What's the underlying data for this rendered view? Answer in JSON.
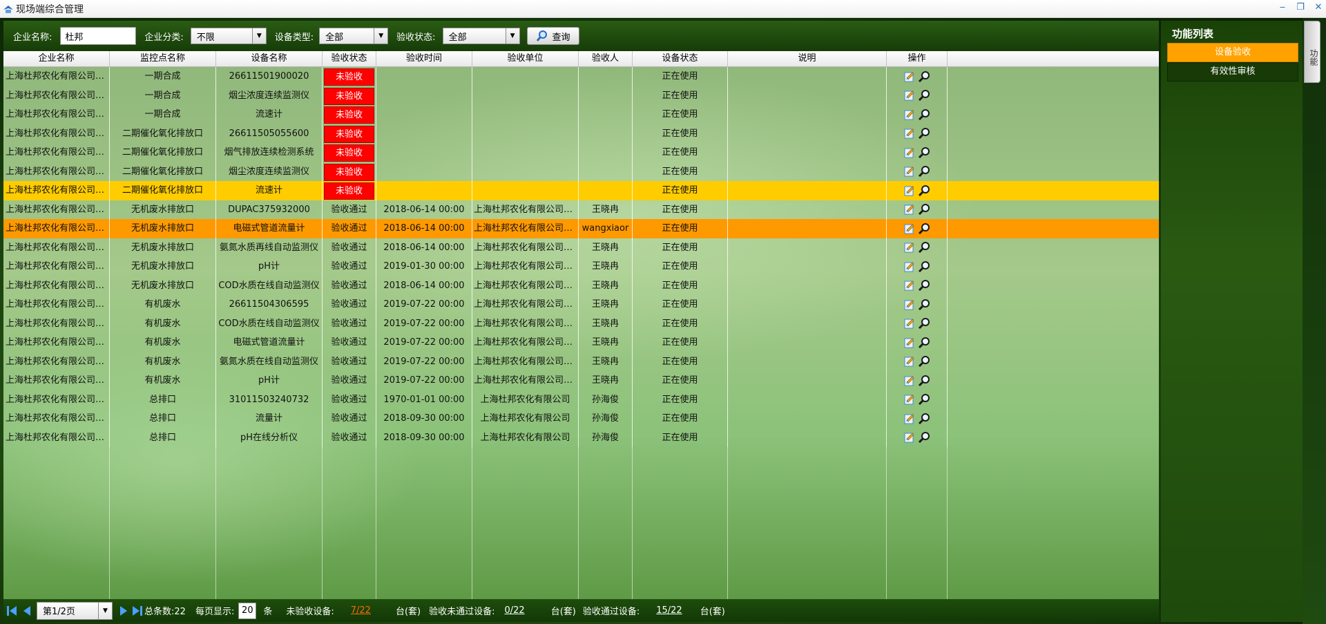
{
  "window": {
    "title": "现场端综合管理",
    "controls": [
      "minimize",
      "restore",
      "close"
    ]
  },
  "toolbar": {
    "company_name_label": "企业名称:",
    "company_name_value": "杜邦",
    "company_category_label": "企业分类:",
    "company_category_value": "不限",
    "device_type_label": "设备类型:",
    "device_type_value": "全部",
    "accept_status_label": "验收状态:",
    "accept_status_value": "全部",
    "query_label": "查询"
  },
  "grid": {
    "columns": [
      "企业名称",
      "监控点名称",
      "设备名称",
      "验收状态",
      "验收时间",
      "验收单位",
      "验收人",
      "设备状态",
      "说明",
      "操作"
    ],
    "rows": [
      {
        "company": "上海杜邦农化有限公司化工区厂",
        "point": "一期合成",
        "device": "26611501900020",
        "status": "未验收",
        "time": "",
        "unit": "",
        "person": "",
        "dstatus": "正在使用",
        "note": "",
        "highlight": ""
      },
      {
        "company": "上海杜邦农化有限公司化工区厂",
        "point": "一期合成",
        "device": "烟尘浓度连续监测仪",
        "status": "未验收",
        "time": "",
        "unit": "",
        "person": "",
        "dstatus": "正在使用",
        "note": "",
        "highlight": ""
      },
      {
        "company": "上海杜邦农化有限公司化工区厂",
        "point": "一期合成",
        "device": "流速计",
        "status": "未验收",
        "time": "",
        "unit": "",
        "person": "",
        "dstatus": "正在使用",
        "note": "",
        "highlight": ""
      },
      {
        "company": "上海杜邦农化有限公司化工区厂",
        "point": "二期催化氧化排放口",
        "device": "26611505055600",
        "status": "未验收",
        "time": "",
        "unit": "",
        "person": "",
        "dstatus": "正在使用",
        "note": "",
        "highlight": ""
      },
      {
        "company": "上海杜邦农化有限公司化工区厂",
        "point": "二期催化氧化排放口",
        "device": "烟气排放连续检测系统",
        "status": "未验收",
        "time": "",
        "unit": "",
        "person": "",
        "dstatus": "正在使用",
        "note": "",
        "highlight": ""
      },
      {
        "company": "上海杜邦农化有限公司化工区厂",
        "point": "二期催化氧化排放口",
        "device": "烟尘浓度连续监测仪",
        "status": "未验收",
        "time": "",
        "unit": "",
        "person": "",
        "dstatus": "正在使用",
        "note": "",
        "highlight": ""
      },
      {
        "company": "上海杜邦农化有限公司化工区厂",
        "point": "二期催化氧化排放口",
        "device": "流速计",
        "status": "未验收",
        "time": "",
        "unit": "",
        "person": "",
        "dstatus": "正在使用",
        "note": "",
        "highlight": "yellow"
      },
      {
        "company": "上海杜邦农化有限公司化工区厂",
        "point": "无机废水排放口",
        "device": "DUPAC375932000",
        "status": "验收通过",
        "time": "2018-06-14 00:00",
        "unit": "上海杜邦农化有限公司化工区厂",
        "person": "王晓冉",
        "dstatus": "正在使用",
        "note": "",
        "highlight": ""
      },
      {
        "company": "上海杜邦农化有限公司化工区厂",
        "point": "无机废水排放口",
        "device": "电磁式管道流量计",
        "status": "验收通过",
        "time": "2018-06-14 00:00",
        "unit": "上海杜邦农化有限公司化工区厂",
        "person": "wangxiaor",
        "dstatus": "正在使用",
        "note": "",
        "highlight": "orange"
      },
      {
        "company": "上海杜邦农化有限公司化工区厂",
        "point": "无机废水排放口",
        "device": "氨氮水质再线自动监测仪",
        "status": "验收通过",
        "time": "2018-06-14 00:00",
        "unit": "上海杜邦农化有限公司化工区厂",
        "person": "王晓冉",
        "dstatus": "正在使用",
        "note": "",
        "highlight": ""
      },
      {
        "company": "上海杜邦农化有限公司化工区厂",
        "point": "无机废水排放口",
        "device": "pH计",
        "status": "验收通过",
        "time": "2019-01-30 00:00",
        "unit": "上海杜邦农化有限公司化工区厂",
        "person": "王晓冉",
        "dstatus": "正在使用",
        "note": "",
        "highlight": ""
      },
      {
        "company": "上海杜邦农化有限公司化工区厂",
        "point": "无机废水排放口",
        "device": "COD水质在线自动监测仪",
        "status": "验收通过",
        "time": "2018-06-14 00:00",
        "unit": "上海杜邦农化有限公司化工区厂",
        "person": "王晓冉",
        "dstatus": "正在使用",
        "note": "",
        "highlight": ""
      },
      {
        "company": "上海杜邦农化有限公司化工区厂",
        "point": "有机废水",
        "device": "26611504306595",
        "status": "验收通过",
        "time": "2019-07-22 00:00",
        "unit": "上海杜邦农化有限公司化工区厂",
        "person": "王晓冉",
        "dstatus": "正在使用",
        "note": "",
        "highlight": ""
      },
      {
        "company": "上海杜邦农化有限公司化工区厂",
        "point": "有机废水",
        "device": "COD水质在线自动监测仪",
        "status": "验收通过",
        "time": "2019-07-22 00:00",
        "unit": "上海杜邦农化有限公司化工区厂",
        "person": "王晓冉",
        "dstatus": "正在使用",
        "note": "",
        "highlight": ""
      },
      {
        "company": "上海杜邦农化有限公司化工区厂",
        "point": "有机废水",
        "device": "电磁式管道流量计",
        "status": "验收通过",
        "time": "2019-07-22 00:00",
        "unit": "上海杜邦农化有限公司化工区厂",
        "person": "王晓冉",
        "dstatus": "正在使用",
        "note": "",
        "highlight": ""
      },
      {
        "company": "上海杜邦农化有限公司化工区厂",
        "point": "有机废水",
        "device": "氨氮水质在线自动监测仪",
        "status": "验收通过",
        "time": "2019-07-22 00:00",
        "unit": "上海杜邦农化有限公司化工...",
        "person": "王晓冉",
        "dstatus": "正在使用",
        "note": "",
        "highlight": ""
      },
      {
        "company": "上海杜邦农化有限公司化工区厂",
        "point": "有机废水",
        "device": "pH计",
        "status": "验收通过",
        "time": "2019-07-22 00:00",
        "unit": "上海杜邦农化有限公司化工区厂",
        "person": "王晓冉",
        "dstatus": "正在使用",
        "note": "",
        "highlight": ""
      },
      {
        "company": "上海杜邦农化有限公司（浦东）",
        "point": "总排口",
        "device": "31011503240732",
        "status": "验收通过",
        "time": "1970-01-01 00:00",
        "unit": "上海杜邦农化有限公司",
        "person": "孙海俊",
        "dstatus": "正在使用",
        "note": "",
        "highlight": ""
      },
      {
        "company": "上海杜邦农化有限公司（浦东）",
        "point": "总排口",
        "device": "流量计",
        "status": "验收通过",
        "time": "2018-09-30 00:00",
        "unit": "上海杜邦农化有限公司",
        "person": "孙海俊",
        "dstatus": "正在使用",
        "note": "",
        "highlight": ""
      },
      {
        "company": "上海杜邦农化有限公司（浦东）",
        "point": "总排口",
        "device": "pH在线分析仪",
        "status": "验收通过",
        "time": "2018-09-30 00:00",
        "unit": "上海杜邦农化有限公司",
        "person": "孙海俊",
        "dstatus": "正在使用",
        "note": "",
        "highlight": ""
      }
    ]
  },
  "pager": {
    "page_value": "第1/2页",
    "total_label": "总条数:22",
    "page_size_label": "每页显示:",
    "page_size_value": "20",
    "page_size_unit": "条",
    "unaccepted_label": "未验收设备:",
    "unaccepted_value": "7/22",
    "unit1": "台(套)",
    "failed_label": "验收未通过设备:",
    "failed_value": "0/22",
    "unit2": "台(套)",
    "passed_label": "验收通过设备:",
    "passed_value": "15/22",
    "unit3": "台(套)"
  },
  "right_panel": {
    "title": "功能列表",
    "items": [
      "设备验收",
      "有效性审核"
    ],
    "side_tab_label": "功能"
  },
  "colors": {
    "status_unaccepted": "#ff0000",
    "row_highlight_yellow": "#ffcc00",
    "row_highlight_orange": "#ff9900",
    "panel_active": "#ffa200"
  }
}
